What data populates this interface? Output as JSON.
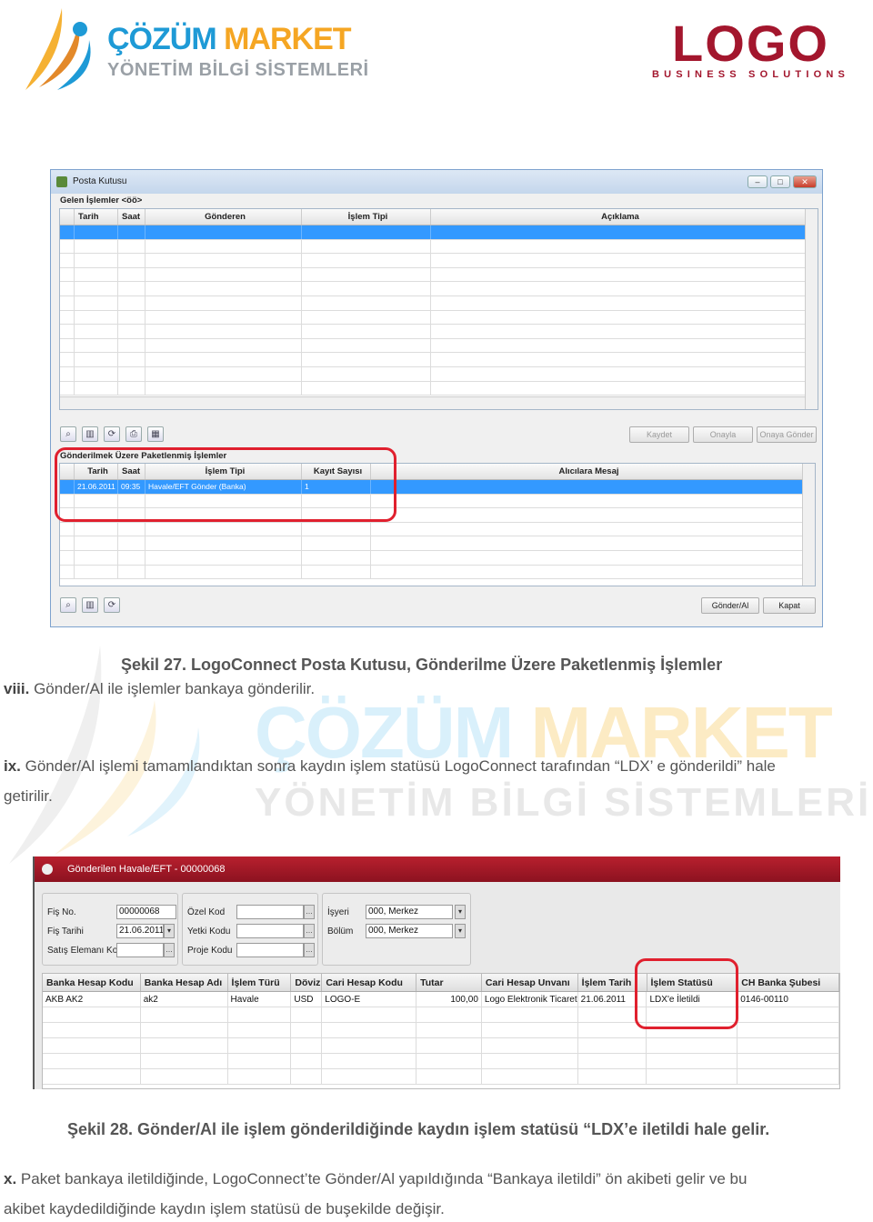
{
  "header": {
    "brand_left_line1_a": "ÇÖZÜM",
    "brand_left_line1_b": "MARKET",
    "brand_left_line2": "YÖNETİM BİLGİ SİSTEMLERİ",
    "brand_right_big": "LOGO",
    "brand_right_small": "BUSINESS SOLUTIONS"
  },
  "window1": {
    "title": "Posta Kutusu",
    "incoming_label": "Gelen İşlemler <öö>",
    "incoming_columns": [
      "Tarih",
      "Saat",
      "Gönderen",
      "İşlem Tipi",
      "Açıklama"
    ],
    "buttons": {
      "save": "Kaydet",
      "approve": "Onayla",
      "send_for_approval": "Onaya Gönder",
      "send_receive": "Gönder/Al",
      "close": "Kapat"
    },
    "packaged_label": "Gönderilmek Üzere Paketlenmiş İşlemler",
    "packaged_columns": [
      "Tarih",
      "Saat",
      "İşlem Tipi",
      "Kayıt Sayısı",
      "Alıcılara Mesaj"
    ],
    "packaged_rows": [
      [
        "21.06.2011",
        "09:35",
        "Havale/EFT Gönder (Banka)",
        "1",
        ""
      ]
    ]
  },
  "caption27": "Şekil 27. LogoConnect Posta Kutusu, Gönderilme Üzere Paketlenmiş İşlemler",
  "para_viii": {
    "num": "viii.",
    "text": " Gönder/Al ile işlemler bankaya gönderilir."
  },
  "para_ix": {
    "num": "ix.",
    "line1": " Gönder/Al işlemi tamamlandıktan sonra kaydın işlem statüsü LogoConnect tarafından “LDX’ e gönderildi” hale",
    "line2": "getirilir."
  },
  "window2": {
    "title": "Gönderilen Havale/EFT - 00000068",
    "fields": {
      "fis_no_label": "Fiş No.",
      "fis_no": "00000068",
      "fis_tarihi_label": "Fiş Tarihi",
      "fis_tarihi": "21.06.2011",
      "satis_label": "Satış Elemanı Kodu",
      "ozel_kod_label": "Özel Kod",
      "yetki_kodu_label": "Yetki Kodu",
      "proje_kodu_label": "Proje Kodu",
      "isyeri_label": "İşyeri",
      "isyeri": "000, Merkez",
      "bolum_label": "Bölüm",
      "bolum": "000, Merkez"
    },
    "columns": [
      "Banka Hesap Kodu",
      "Banka Hesap Adı",
      "İşlem Türü",
      "Döviz",
      "Cari Hesap Kodu",
      "Tutar",
      "Cari Hesap Unvanı",
      "İşlem Tarih",
      "İşlem Statüsü",
      "CH Banka Şubesi"
    ],
    "row": [
      "AKB   AK2",
      "ak2",
      "Havale",
      "USD",
      "LOGO-E",
      "100,00",
      "Logo Elektronik Ticaret Hizmetl",
      "21.06.2011",
      "LDX'e İletildi",
      "0146-00110"
    ]
  },
  "caption28": "Şekil 28. Gönder/Al ile işlem gönderildiğinde kaydın işlem statüsü “LDX’e iletildi hale gelir.",
  "para_x": {
    "num": "x.",
    "line1": " Paket bankaya iletildiğinde, LogoConnect’te Gönder/Al yapıldığında “Bankaya iletildi” ön akibeti gelir ve bu",
    "line2": "akibet kaydedildiğinde kaydın işlem statüsü de buşekilde değişir."
  },
  "colors": {
    "accent_blue": "#1e9ad6",
    "accent_orange": "#f5a623",
    "logo_red": "#a3162d",
    "highlight": "#e0202e",
    "selection": "#3399ff"
  }
}
